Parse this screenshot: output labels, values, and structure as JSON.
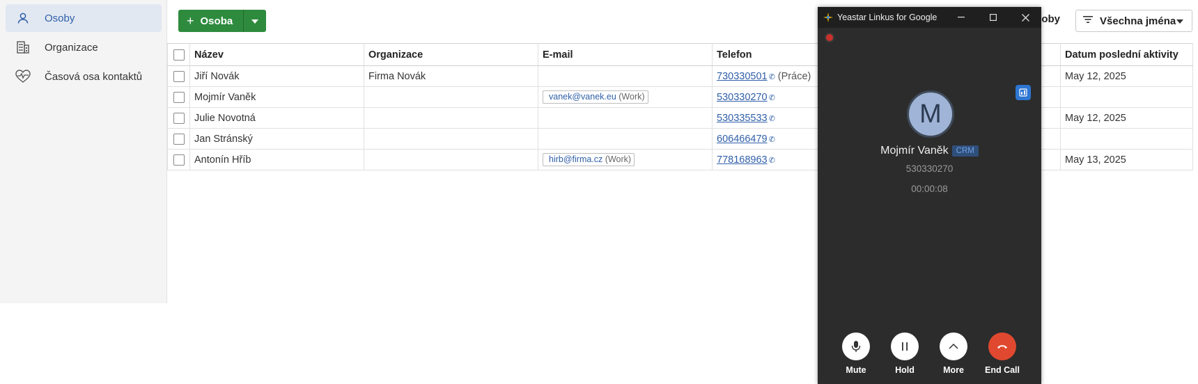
{
  "sidebar": {
    "items": [
      {
        "label": "Osoby",
        "icon": "person-icon",
        "active": true
      },
      {
        "label": "Organizace",
        "icon": "building-icon",
        "active": false
      },
      {
        "label": "Časová osa kontaktů",
        "icon": "heart-pulse-icon",
        "active": false
      }
    ]
  },
  "toolbar": {
    "add_label": "Osoba",
    "right_text": "soby",
    "filter_label": "Všechna jména"
  },
  "table": {
    "headers": [
      "Název",
      "Organizace",
      "E-mail",
      "Telefon",
      "Datum poslední aktivity"
    ],
    "rows": [
      {
        "name": "Jiří Novák",
        "org": "Firma Novák",
        "email": "",
        "email_tag": "",
        "phone": "730330501",
        "phone_type": "(Práce)",
        "last_activity": "May 12, 2025"
      },
      {
        "name": "Mojmír Vaněk",
        "org": "",
        "email": "vanek@vanek.eu",
        "email_tag": "(Work)",
        "phone": "530330270",
        "phone_type": "",
        "last_activity": ""
      },
      {
        "name": "Julie Novotná",
        "org": "",
        "email": "",
        "email_tag": "",
        "phone": "530335533",
        "phone_type": "",
        "last_activity": "May 12, 2025"
      },
      {
        "name": "Jan Stránský",
        "org": "",
        "email": "",
        "email_tag": "",
        "phone": "606466479",
        "phone_type": "",
        "last_activity": ""
      },
      {
        "name": "Antonín Hříb",
        "org": "",
        "email": "hirb@firma.cz",
        "email_tag": "(Work)",
        "phone": "778168963",
        "phone_type": "",
        "last_activity": "May 13, 2025"
      }
    ]
  },
  "popup": {
    "title": "Yeastar Linkus for Google",
    "avatar_letter": "M",
    "caller_name": "Mojmír Vaněk",
    "caller_tag": "CRM",
    "caller_number": "530330270",
    "duration": "00:00:08",
    "controls": {
      "mute": "Mute",
      "hold": "Hold",
      "more": "More",
      "end": "End Call"
    }
  },
  "colors": {
    "accent_green": "#2e8b3d",
    "link_blue": "#2f5fa8",
    "popup_bg": "#2c2c2c",
    "end_call_red": "#e0492f"
  }
}
